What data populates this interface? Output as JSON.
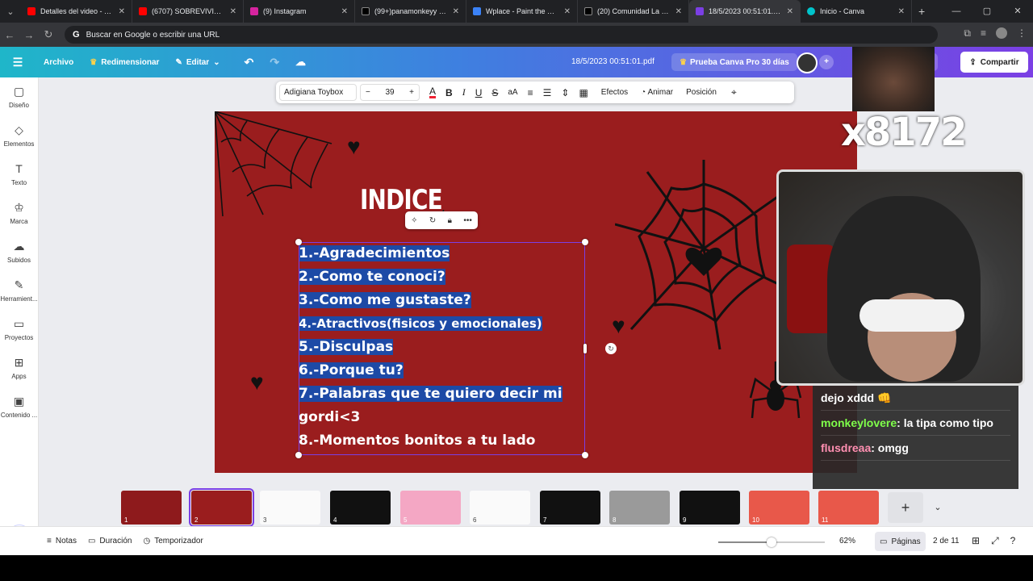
{
  "browser": {
    "tabs": [
      {
        "title": "Detalles del video - YouTube",
        "color": "#ff0000",
        "active": false
      },
      {
        "title": "(6707) SOBREVIVIMOS 99",
        "color": "#ff0000",
        "active": false
      },
      {
        "title": "(9) Instagram",
        "color": "#d6249f",
        "active": false
      },
      {
        "title": "(99+)panamonkeyy (@pa",
        "color": "#000000",
        "active": false
      },
      {
        "title": "Wplace - Paint the world",
        "color": "#3b82f6",
        "active": false
      },
      {
        "title": "(20) Comunidad La Jungl",
        "color": "#000000",
        "active": false
      },
      {
        "title": "18/5/2023 00:51:01.pdf -",
        "color": "#7b3fe4",
        "active": true
      },
      {
        "title": "Inicio - Canva",
        "color": "#00c4cc",
        "active": false
      }
    ],
    "address_placeholder": "Buscar en Google o escribir una URL"
  },
  "canva": {
    "menu": {
      "archivo": "Archivo",
      "redimensionar": "Redimensionar",
      "editar": "Editar"
    },
    "doc_title": "18/5/2023 00:51:01.pdf",
    "pro_label": "Prueba Canva Pro 30 días",
    "present_label": "ntar",
    "share_label": "Compartir",
    "sidebar": [
      {
        "label": "Diseño",
        "icon": "layout-icon",
        "glyph": "▢"
      },
      {
        "label": "Elementos",
        "icon": "shapes-icon",
        "glyph": "◇"
      },
      {
        "label": "Texto",
        "icon": "text-icon",
        "glyph": "T"
      },
      {
        "label": "Marca",
        "icon": "brand-icon",
        "glyph": "♔"
      },
      {
        "label": "Subidos",
        "icon": "upload-icon",
        "glyph": "☁"
      },
      {
        "label": "Herramient...",
        "icon": "tools-icon",
        "glyph": "✎"
      },
      {
        "label": "Proyectos",
        "icon": "folder-icon",
        "glyph": "▭"
      },
      {
        "label": "Apps",
        "icon": "apps-icon",
        "glyph": "⊞"
      },
      {
        "label": "Contenido ...",
        "icon": "media-icon",
        "glyph": "▣"
      }
    ],
    "toolbar": {
      "font": "Adigiana Toybox",
      "size": "39",
      "effects": "Efectos",
      "animate": "Animar",
      "position": "Posición"
    },
    "slide": {
      "title": "INDICE",
      "subtitle": "ntos",
      "items": [
        "1.-Agradecimientos",
        "2.-Como te conoci?",
        "3.-Como me gustaste?",
        "4.-Atractivos(fisicos y emocionales)",
        "5.-Disculpas",
        "6.-Porque tu?",
        "7.-Palabras que te quiero decir mi",
        "gordi<3",
        "8.-Momentos bonitos a tu lado"
      ]
    },
    "thumbnails": [
      "1",
      "2",
      "3",
      "4",
      "5",
      "6",
      "7",
      "8",
      "9",
      "10",
      "11"
    ],
    "bottom": {
      "notes": "Notas",
      "duration": "Duración",
      "timer": "Temporizador",
      "zoom": "62%",
      "zoom_level": 0.5,
      "pages": "Páginas",
      "page_count": "2 de 11"
    }
  },
  "stream": {
    "counter": "x8172",
    "chat": [
      {
        "user": "",
        "message": "dejo xddd 👊",
        "color": "#ffffff"
      },
      {
        "user": "monkeylovere",
        "message": ": la tipa como tipo",
        "color": "#7fff4a"
      },
      {
        "user": "flusdreaa",
        "message": ": omgg",
        "color": "#ff8fb1"
      }
    ]
  }
}
